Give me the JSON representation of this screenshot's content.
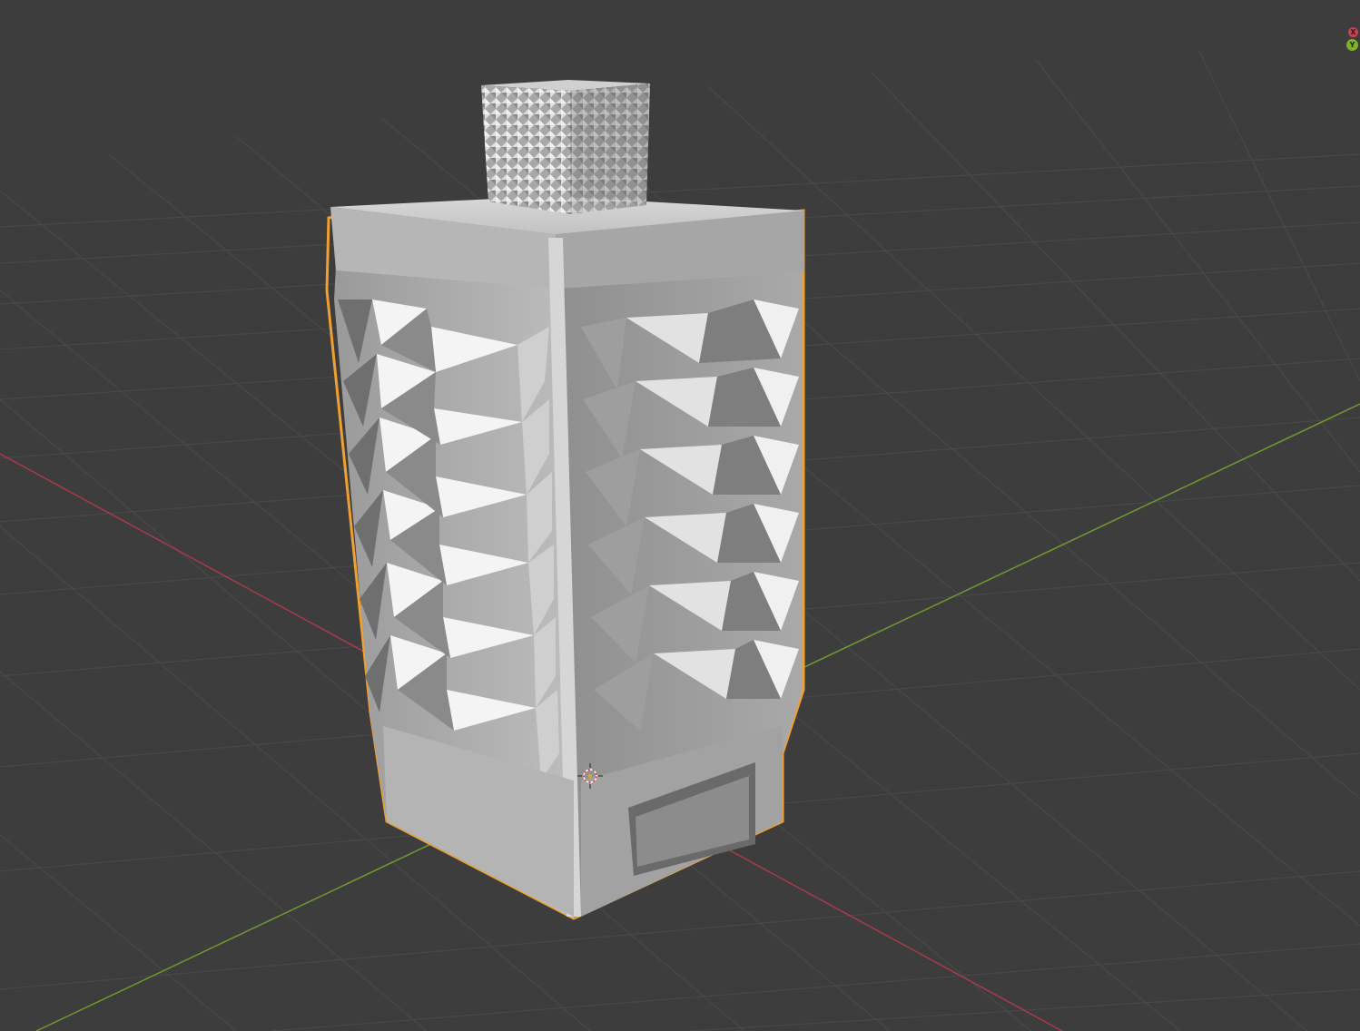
{
  "viewport": {
    "background": "#3d3d3d",
    "grid_color": "#4a4a4a",
    "x_axis_color": "#a83b4a",
    "y_axis_color": "#6f9a2d",
    "selection_outline_color": "#f0a030"
  },
  "gizmo": {
    "x_label": "X",
    "y_label": "Y",
    "x_color": "#c8434f",
    "y_color": "#7bb425"
  },
  "object": {
    "description_icon": "faceted-box-mesh-icon",
    "surface_color": "#c8c8c8",
    "selected": true
  },
  "origin": {
    "icon": "3d-cursor-icon"
  }
}
